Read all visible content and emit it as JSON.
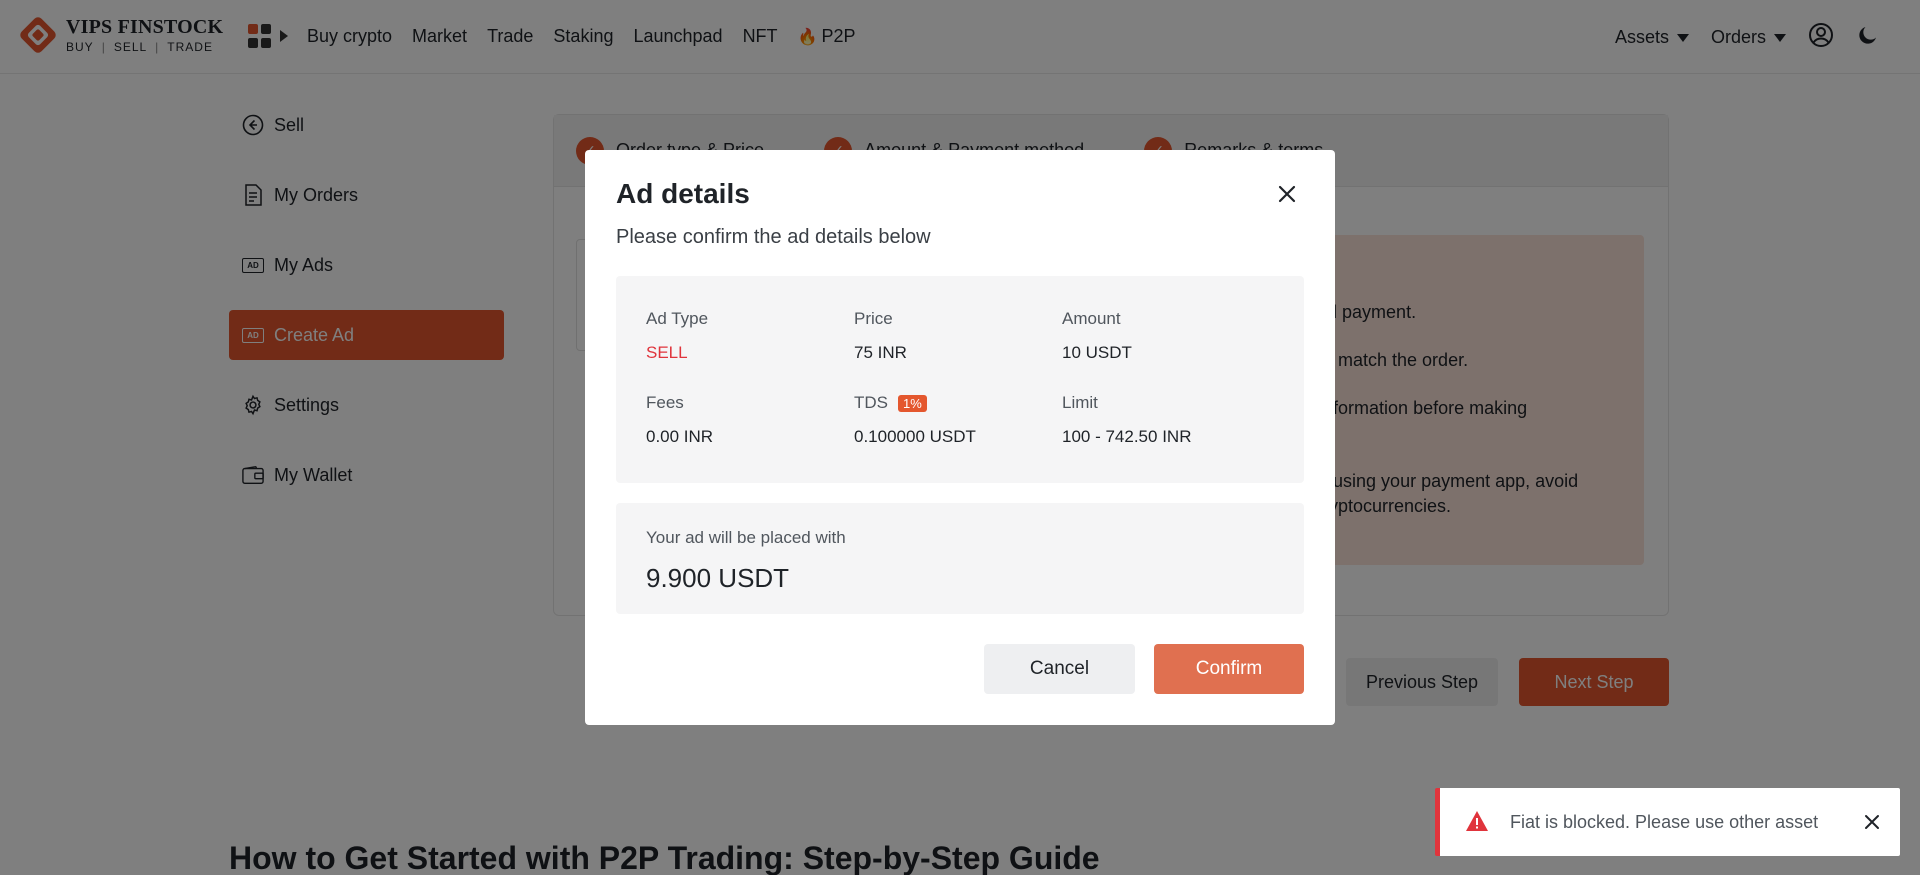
{
  "brand": {
    "name": "VIPS FINSTOCK",
    "tagline": [
      "BUY",
      "SELL",
      "TRADE"
    ],
    "accent": "#e4572e"
  },
  "nav": {
    "items": [
      "Buy crypto",
      "Market",
      "Trade",
      "Staking",
      "Launchpad",
      "NFT",
      "P2P"
    ],
    "assets": "Assets",
    "orders": "Orders"
  },
  "sidebar": {
    "items": [
      {
        "label": "Sell",
        "icon": "arrow-left-circle-icon"
      },
      {
        "label": "My Orders",
        "icon": "document-icon"
      },
      {
        "label": "My Ads",
        "icon": "ad-icon"
      },
      {
        "label": "Create Ad",
        "icon": "ad-icon",
        "active": true
      },
      {
        "label": "Settings",
        "icon": "gear-icon"
      },
      {
        "label": "My Wallet",
        "icon": "wallet-icon"
      }
    ]
  },
  "steps": [
    "Order type & Price",
    "Amount & Payment method",
    "Remarks & terms"
  ],
  "tips": [
    "eived payment.",
    "must match the order.",
    "he information before making",
    "ents using your payment app, avoid",
    "to cryptocurrencies."
  ],
  "buttons": {
    "previous": "Previous Step",
    "next": "Next Step"
  },
  "guide_title": "How to Get Started with P2P Trading: Step-by-Step Guide",
  "modal": {
    "title": "Ad details",
    "subtitle": "Please confirm the ad details below",
    "ad_type_label": "Ad Type",
    "ad_type_value": "SELL",
    "price_label": "Price",
    "price_value": "75 INR",
    "amount_label": "Amount",
    "amount_value": "10 USDT",
    "fees_label": "Fees",
    "fees_value": "0.00 INR",
    "tds_label": "TDS",
    "tds_badge": "1%",
    "tds_value": "0.100000 USDT",
    "limit_label": "Limit",
    "limit_value": "100 - 742.50 INR",
    "placed_label": "Your ad will be placed with",
    "placed_value": "9.900 USDT",
    "cancel": "Cancel",
    "confirm": "Confirm"
  },
  "toast": {
    "message": "Fiat is blocked. Please use other asset",
    "color": "#e0343c"
  }
}
